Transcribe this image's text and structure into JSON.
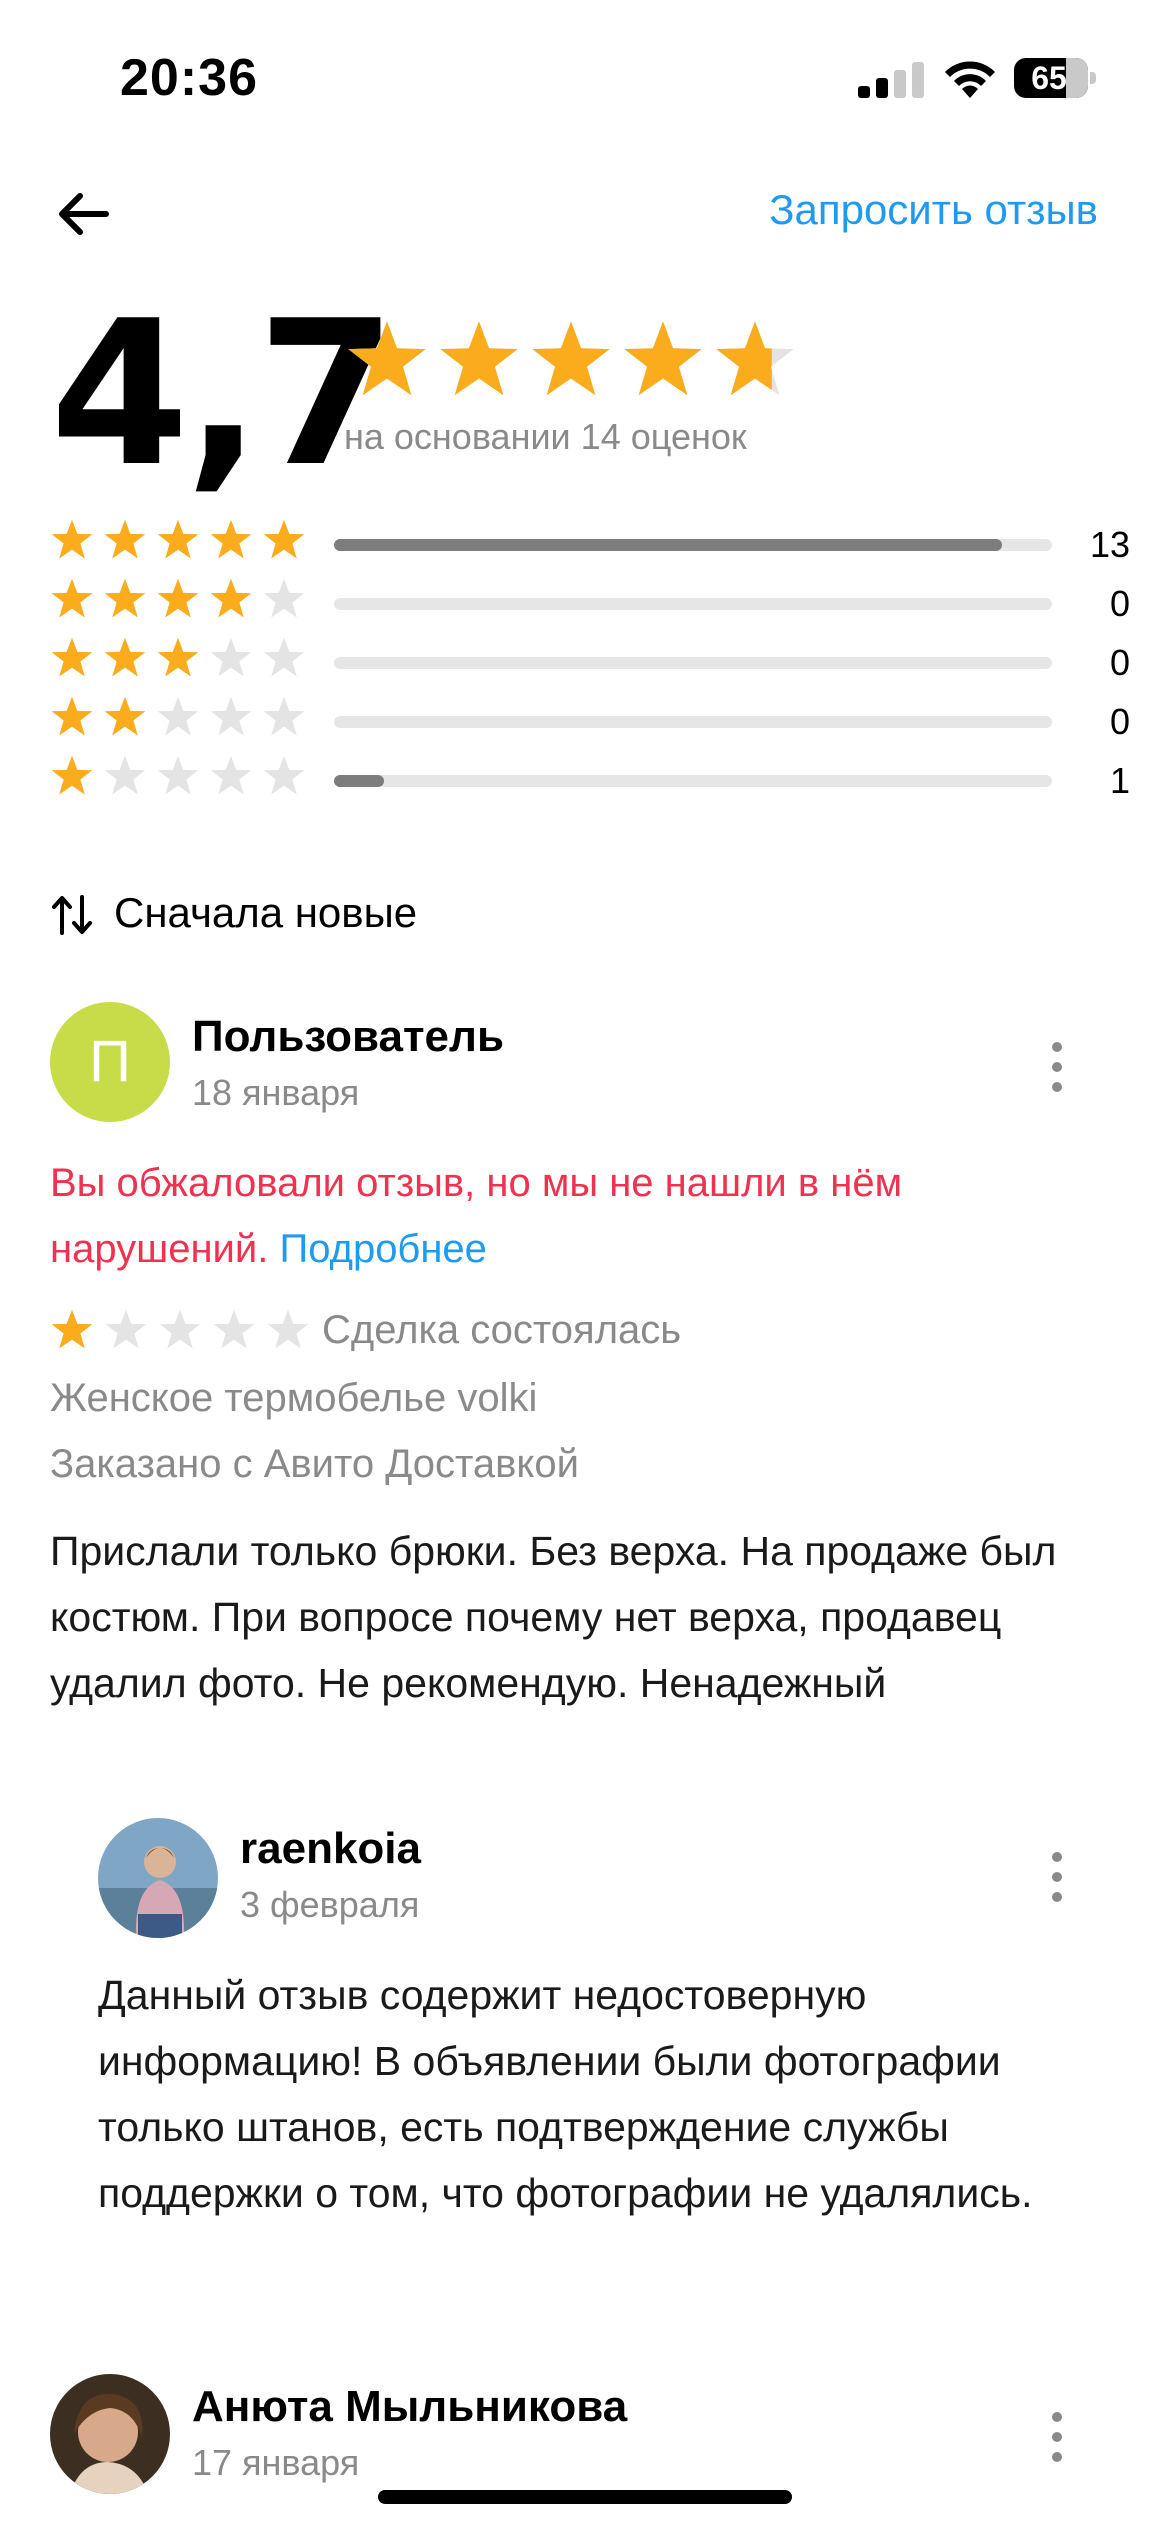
{
  "status": {
    "time": "20:36",
    "battery": "65"
  },
  "nav": {
    "request_review": "Запросить отзыв"
  },
  "summary": {
    "rating": "4,7",
    "rating_value": 4.7,
    "based_on": "на основании 14 оценок",
    "distribution": [
      {
        "stars": 5,
        "count": "13",
        "fraction": 0.93
      },
      {
        "stars": 4,
        "count": "0",
        "fraction": 0
      },
      {
        "stars": 3,
        "count": "0",
        "fraction": 0
      },
      {
        "stars": 2,
        "count": "0",
        "fraction": 0
      },
      {
        "stars": 1,
        "count": "1",
        "fraction": 0.07
      }
    ]
  },
  "sort": {
    "label": "Сначала новые"
  },
  "reviews": [
    {
      "avatar_letter": "П",
      "author": "Пользователь",
      "date": "18 января",
      "appeal_text": "Вы обжаловали отзыв, но мы не нашли в нём нарушений.",
      "appeal_more": "Подробнее",
      "stars": 1,
      "deal": "Сделка состоялась",
      "item": "Женское термобелье volki",
      "delivery": "Заказано с Авито Доставкой",
      "text": "Прислали только брюки.  Без верха.   На продаже был костюм. При вопросе почему нет верха, продавец удалил фото. Не рекомендую. Ненадежный",
      "reply": {
        "author": "raenkoia",
        "date": "3 февраля",
        "text": "Данный отзыв содержит недостоверную информацию! В объявлении были фотографии только штанов, есть подтверждение службы поддержки о том, что фотографии не удалялись."
      }
    },
    {
      "author": "Анюта Мыльникова",
      "date": "17 января"
    }
  ],
  "colors": {
    "star": "#fbac1c",
    "star_empty": "#e4e4e4",
    "link": "#1e9bf0",
    "warning": "#f0314f",
    "avatar": "#c8dc4a"
  },
  "icons": [
    "back-arrow-icon",
    "star-icon",
    "sort-icon",
    "more-vertical-icon",
    "signal-icon",
    "wifi-icon",
    "battery-icon"
  ]
}
